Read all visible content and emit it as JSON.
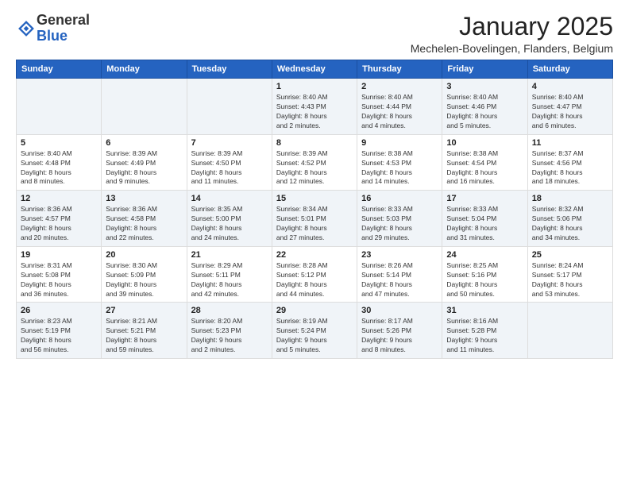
{
  "logo": {
    "general": "General",
    "blue": "Blue"
  },
  "header": {
    "title": "January 2025",
    "subtitle": "Mechelen-Bovelingen, Flanders, Belgium"
  },
  "weekdays": [
    "Sunday",
    "Monday",
    "Tuesday",
    "Wednesday",
    "Thursday",
    "Friday",
    "Saturday"
  ],
  "weeks": [
    [
      {
        "day": "",
        "info": ""
      },
      {
        "day": "",
        "info": ""
      },
      {
        "day": "",
        "info": ""
      },
      {
        "day": "1",
        "info": "Sunrise: 8:40 AM\nSunset: 4:43 PM\nDaylight: 8 hours\nand 2 minutes."
      },
      {
        "day": "2",
        "info": "Sunrise: 8:40 AM\nSunset: 4:44 PM\nDaylight: 8 hours\nand 4 minutes."
      },
      {
        "day": "3",
        "info": "Sunrise: 8:40 AM\nSunset: 4:46 PM\nDaylight: 8 hours\nand 5 minutes."
      },
      {
        "day": "4",
        "info": "Sunrise: 8:40 AM\nSunset: 4:47 PM\nDaylight: 8 hours\nand 6 minutes."
      }
    ],
    [
      {
        "day": "5",
        "info": "Sunrise: 8:40 AM\nSunset: 4:48 PM\nDaylight: 8 hours\nand 8 minutes."
      },
      {
        "day": "6",
        "info": "Sunrise: 8:39 AM\nSunset: 4:49 PM\nDaylight: 8 hours\nand 9 minutes."
      },
      {
        "day": "7",
        "info": "Sunrise: 8:39 AM\nSunset: 4:50 PM\nDaylight: 8 hours\nand 11 minutes."
      },
      {
        "day": "8",
        "info": "Sunrise: 8:39 AM\nSunset: 4:52 PM\nDaylight: 8 hours\nand 12 minutes."
      },
      {
        "day": "9",
        "info": "Sunrise: 8:38 AM\nSunset: 4:53 PM\nDaylight: 8 hours\nand 14 minutes."
      },
      {
        "day": "10",
        "info": "Sunrise: 8:38 AM\nSunset: 4:54 PM\nDaylight: 8 hours\nand 16 minutes."
      },
      {
        "day": "11",
        "info": "Sunrise: 8:37 AM\nSunset: 4:56 PM\nDaylight: 8 hours\nand 18 minutes."
      }
    ],
    [
      {
        "day": "12",
        "info": "Sunrise: 8:36 AM\nSunset: 4:57 PM\nDaylight: 8 hours\nand 20 minutes."
      },
      {
        "day": "13",
        "info": "Sunrise: 8:36 AM\nSunset: 4:58 PM\nDaylight: 8 hours\nand 22 minutes."
      },
      {
        "day": "14",
        "info": "Sunrise: 8:35 AM\nSunset: 5:00 PM\nDaylight: 8 hours\nand 24 minutes."
      },
      {
        "day": "15",
        "info": "Sunrise: 8:34 AM\nSunset: 5:01 PM\nDaylight: 8 hours\nand 27 minutes."
      },
      {
        "day": "16",
        "info": "Sunrise: 8:33 AM\nSunset: 5:03 PM\nDaylight: 8 hours\nand 29 minutes."
      },
      {
        "day": "17",
        "info": "Sunrise: 8:33 AM\nSunset: 5:04 PM\nDaylight: 8 hours\nand 31 minutes."
      },
      {
        "day": "18",
        "info": "Sunrise: 8:32 AM\nSunset: 5:06 PM\nDaylight: 8 hours\nand 34 minutes."
      }
    ],
    [
      {
        "day": "19",
        "info": "Sunrise: 8:31 AM\nSunset: 5:08 PM\nDaylight: 8 hours\nand 36 minutes."
      },
      {
        "day": "20",
        "info": "Sunrise: 8:30 AM\nSunset: 5:09 PM\nDaylight: 8 hours\nand 39 minutes."
      },
      {
        "day": "21",
        "info": "Sunrise: 8:29 AM\nSunset: 5:11 PM\nDaylight: 8 hours\nand 42 minutes."
      },
      {
        "day": "22",
        "info": "Sunrise: 8:28 AM\nSunset: 5:12 PM\nDaylight: 8 hours\nand 44 minutes."
      },
      {
        "day": "23",
        "info": "Sunrise: 8:26 AM\nSunset: 5:14 PM\nDaylight: 8 hours\nand 47 minutes."
      },
      {
        "day": "24",
        "info": "Sunrise: 8:25 AM\nSunset: 5:16 PM\nDaylight: 8 hours\nand 50 minutes."
      },
      {
        "day": "25",
        "info": "Sunrise: 8:24 AM\nSunset: 5:17 PM\nDaylight: 8 hours\nand 53 minutes."
      }
    ],
    [
      {
        "day": "26",
        "info": "Sunrise: 8:23 AM\nSunset: 5:19 PM\nDaylight: 8 hours\nand 56 minutes."
      },
      {
        "day": "27",
        "info": "Sunrise: 8:21 AM\nSunset: 5:21 PM\nDaylight: 8 hours\nand 59 minutes."
      },
      {
        "day": "28",
        "info": "Sunrise: 8:20 AM\nSunset: 5:23 PM\nDaylight: 9 hours\nand 2 minutes."
      },
      {
        "day": "29",
        "info": "Sunrise: 8:19 AM\nSunset: 5:24 PM\nDaylight: 9 hours\nand 5 minutes."
      },
      {
        "day": "30",
        "info": "Sunrise: 8:17 AM\nSunset: 5:26 PM\nDaylight: 9 hours\nand 8 minutes."
      },
      {
        "day": "31",
        "info": "Sunrise: 8:16 AM\nSunset: 5:28 PM\nDaylight: 9 hours\nand 11 minutes."
      },
      {
        "day": "",
        "info": ""
      }
    ]
  ]
}
